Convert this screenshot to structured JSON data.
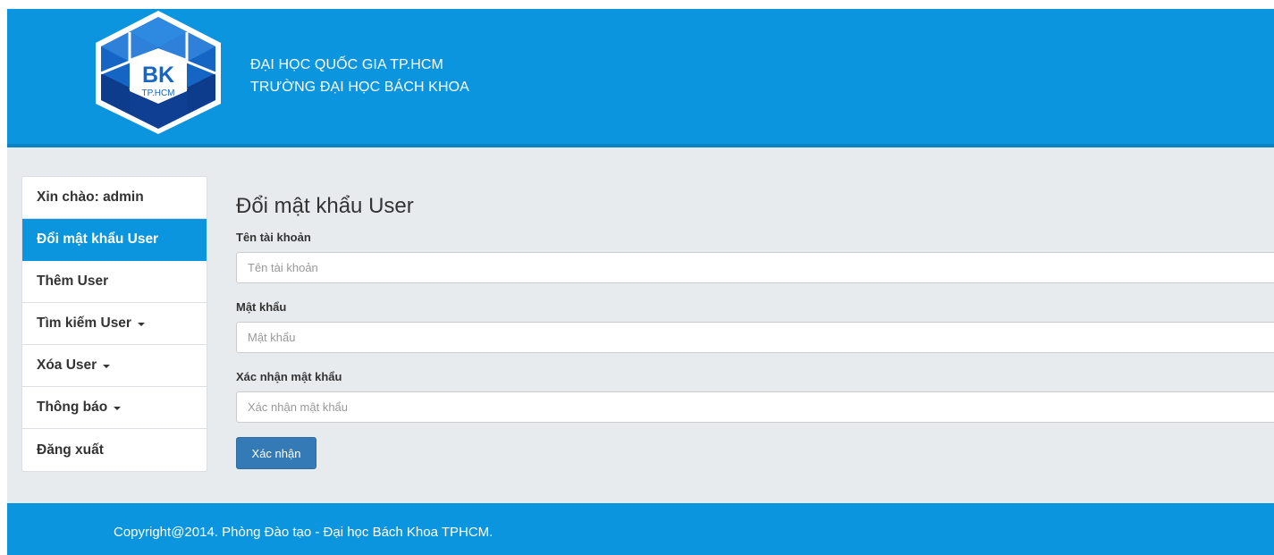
{
  "header": {
    "logo": {
      "icon": "bk-hexagon-logo",
      "text_main": "BK",
      "text_sub": "TP.HCM"
    },
    "line1": "ĐẠI HỌC QUỐC GIA TP.HCM",
    "line2": "TRƯỜNG ĐẠI HỌC BÁCH KHOA"
  },
  "sidebar": {
    "greeting": "Xin chào: admin",
    "items": [
      {
        "label": "Đổi mật khẩu User",
        "active": true,
        "dropdown": false
      },
      {
        "label": "Thêm User",
        "active": false,
        "dropdown": false
      },
      {
        "label": "Tìm kiếm User",
        "active": false,
        "dropdown": true
      },
      {
        "label": "Xóa User",
        "active": false,
        "dropdown": true
      },
      {
        "label": "Thông báo",
        "active": false,
        "dropdown": true
      },
      {
        "label": "Đăng xuất",
        "active": false,
        "dropdown": false
      }
    ]
  },
  "form": {
    "title": "Đổi mật khẩu User",
    "username": {
      "label": "Tên tài khoản",
      "placeholder": "Tên tài khoản",
      "value": ""
    },
    "password": {
      "label": "Mật khẩu",
      "placeholder": "Mật khẩu",
      "value": ""
    },
    "confirm": {
      "label": "Xác nhận mật khẩu",
      "placeholder": "Xác nhận mật khẩu",
      "value": ""
    },
    "submit_label": "Xác nhận"
  },
  "footer": {
    "text": "Copyright@2014. Phòng Đào tạo - Đại học Bách Khoa TPHCM."
  },
  "colors": {
    "primary": "#0a95de",
    "button": "#337ab7",
    "background": "#e8ebed",
    "logo_dark": "#0d3c8c",
    "logo_mid": "#1566c4"
  }
}
